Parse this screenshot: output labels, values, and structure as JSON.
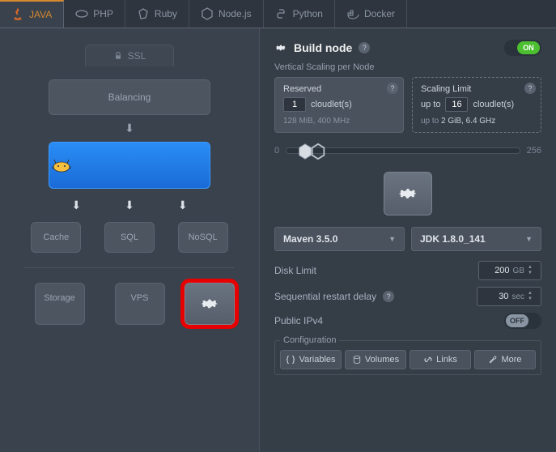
{
  "tabs": [
    {
      "label": "JAVA",
      "icon": "java"
    },
    {
      "label": "PHP",
      "icon": "php"
    },
    {
      "label": "Ruby",
      "icon": "ruby"
    },
    {
      "label": "Node.js",
      "icon": "nodejs"
    },
    {
      "label": "Python",
      "icon": "python"
    },
    {
      "label": "Docker",
      "icon": "docker"
    }
  ],
  "active_tab": 0,
  "topology": {
    "ssl_label": "SSL",
    "balancing_label": "Balancing",
    "app_server": "Tomcat",
    "cache_label": "Cache",
    "sql_label": "SQL",
    "nosql_label": "NoSQL",
    "storage_label": "Storage",
    "vps_label": "VPS"
  },
  "build_node": {
    "title": "Build node",
    "state": "ON",
    "scaling_heading": "Vertical Scaling per Node",
    "reserved": {
      "title": "Reserved",
      "value": "1",
      "unit": "cloudlet(s)",
      "spec": "128 MiB, 400 MHz"
    },
    "limit": {
      "title": "Scaling Limit",
      "prefix": "up to",
      "value": "16",
      "unit": "cloudlet(s)",
      "spec_prefix": "up to",
      "spec": "2 GiB, 6.4 GHz"
    },
    "slider": {
      "min": "0",
      "max": "256"
    },
    "versions": {
      "build": "Maven 3.5.0",
      "jdk": "JDK 1.8.0_141"
    },
    "disk_limit": {
      "label": "Disk Limit",
      "value": "200",
      "unit": "GB"
    },
    "restart_delay": {
      "label": "Sequential restart delay",
      "value": "30",
      "unit": "sec"
    },
    "public_ip": {
      "label": "Public IPv4",
      "state": "OFF"
    },
    "config": {
      "legend": "Configuration",
      "variables": "Variables",
      "volumes": "Volumes",
      "links": "Links",
      "more": "More"
    }
  }
}
